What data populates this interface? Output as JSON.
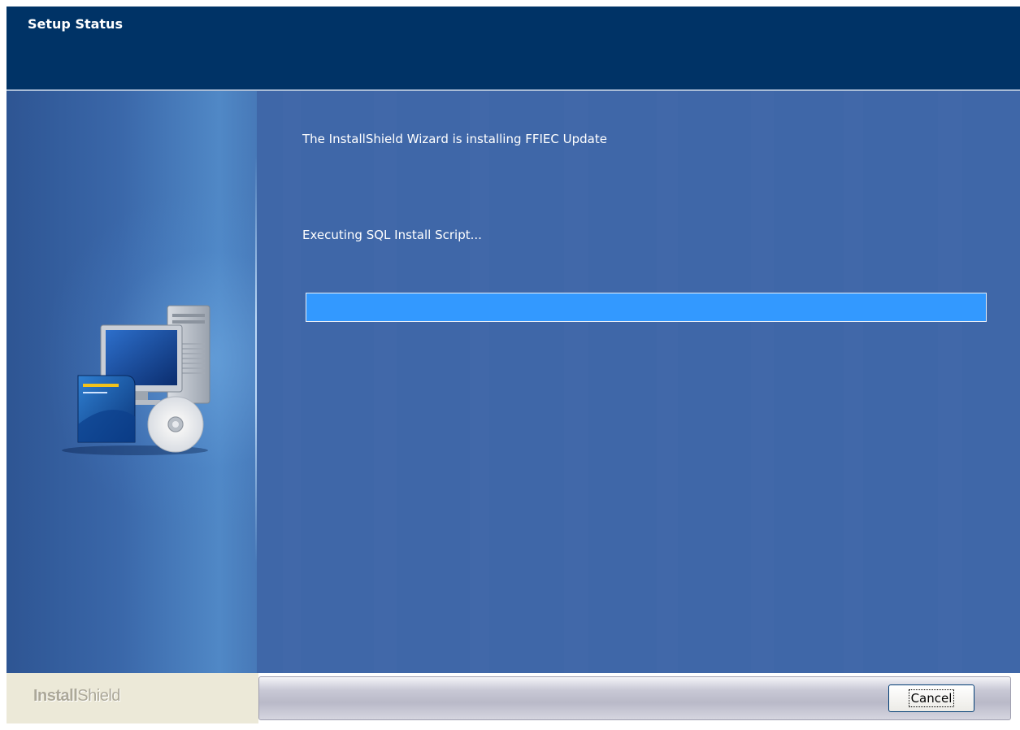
{
  "window": {
    "title": "Setup Status"
  },
  "main": {
    "install_message": "The InstallShield Wizard is installing FFIEC Update",
    "status_message": "Executing SQL Install Script...",
    "progress_percent": 100
  },
  "footer": {
    "brand_prefix": "Install",
    "brand_suffix": "Shield",
    "cancel_label": "Cancel"
  },
  "colors": {
    "header": "#003366",
    "content": "#3f67a8",
    "progress_fill": "#3399ff"
  },
  "icons": {
    "artwork": "computer-with-server-and-cd-icon"
  }
}
